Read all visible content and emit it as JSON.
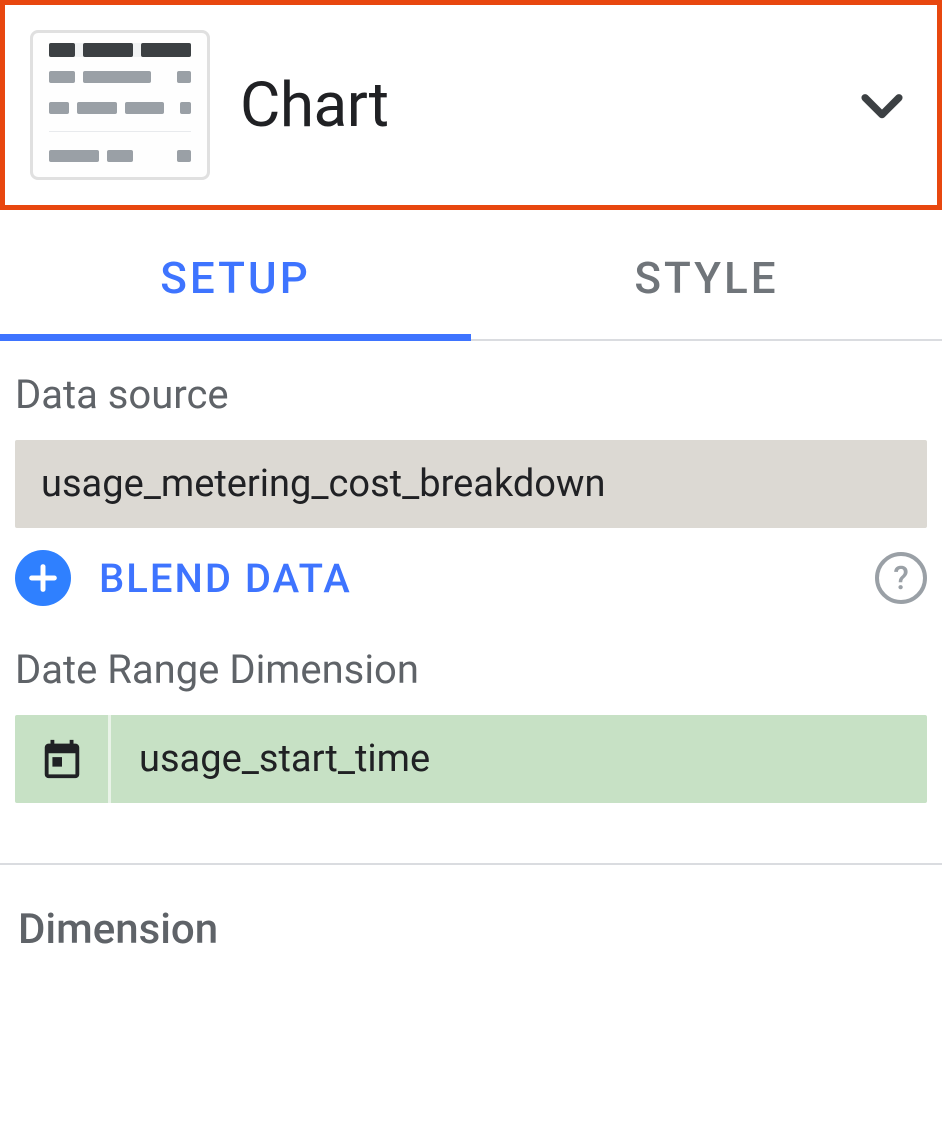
{
  "header": {
    "title": "Chart"
  },
  "tabs": {
    "setup": "SETUP",
    "style": "STYLE"
  },
  "datasource": {
    "label": "Data source",
    "value": "usage_metering_cost_breakdown",
    "blend_label": "BLEND DATA"
  },
  "date_range_dimension": {
    "label": "Date Range Dimension",
    "field": "usage_start_time"
  },
  "dimension": {
    "label": "Dimension"
  }
}
